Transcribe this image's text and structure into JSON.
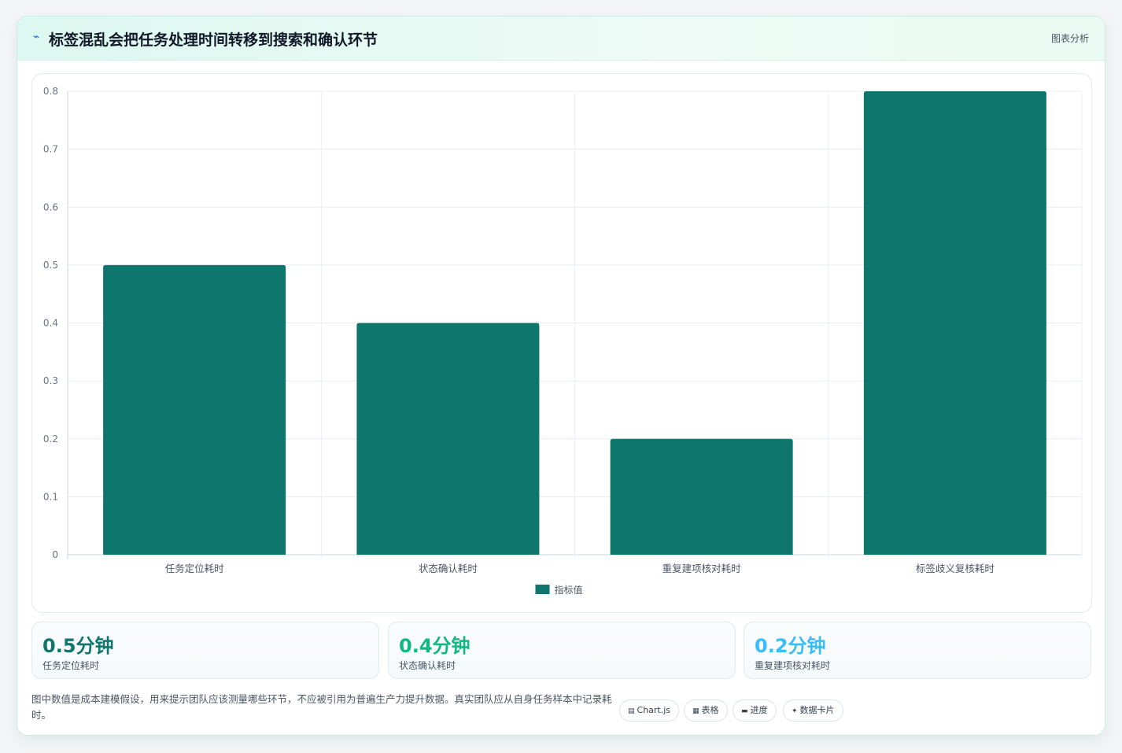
{
  "header": {
    "icon": "trend-icon",
    "title": "标签混乱会把任务处理时间转移到搜索和确认环节",
    "tag": "图表分析"
  },
  "chart_data": {
    "type": "bar",
    "categories": [
      "任务定位耗时",
      "状态确认耗时",
      "重复建项核对耗时",
      "标签歧义复核耗时"
    ],
    "series": [
      {
        "name": "指标值",
        "values": [
          0.5,
          0.4,
          0.2,
          0.8
        ]
      }
    ],
    "ylim": [
      0,
      0.8
    ],
    "yticks": [
      "0",
      "0.1",
      "0.2",
      "0.3",
      "0.4",
      "0.5",
      "0.6",
      "0.7",
      "0.8"
    ],
    "grid": true,
    "legend_position": "bottom",
    "bar_color": "#0f766e"
  },
  "stats": [
    {
      "value": "0.5分钟",
      "label": "任务定位耗时",
      "color": "#0f766e"
    },
    {
      "value": "0.4分钟",
      "label": "状态确认耗时",
      "color": "#10b981"
    },
    {
      "value": "0.2分钟",
      "label": "重复建项核对耗时",
      "color": "#38bdf8"
    }
  ],
  "note": "图中数值是成本建模假设，用来提示团队应该测量哪些环节，不应被引用为普遍生产力提升数据。真实团队应从自身任务样本中记录耗时。",
  "pills": [
    {
      "icon": "chart-icon",
      "label": "Chart.js"
    },
    {
      "icon": "table-icon",
      "label": "表格"
    },
    {
      "icon": "progress-icon",
      "label": "进度"
    },
    {
      "icon": "sparkle-icon",
      "label": "数据卡片"
    }
  ]
}
